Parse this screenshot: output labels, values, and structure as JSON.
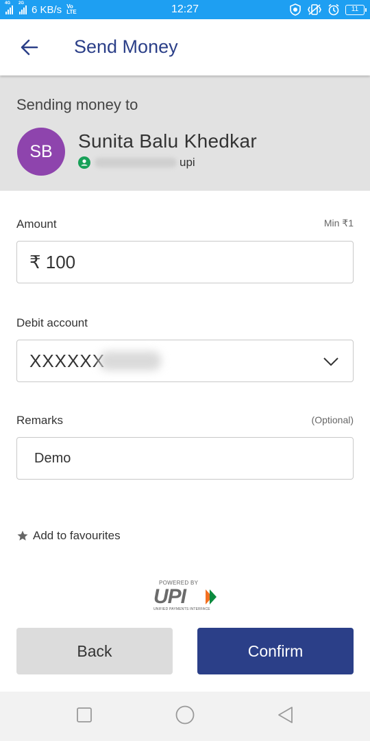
{
  "status_bar": {
    "network_tag_1": "4G",
    "network_tag_2": "2G",
    "speed": "6 KB/s",
    "volte_1": "Vo",
    "volte_2": "LTE",
    "time": "12:27",
    "battery": "11"
  },
  "header": {
    "title": "Send Money"
  },
  "recipient": {
    "label": "Sending money to",
    "initials": "SB",
    "name": "Sunita Balu Khedkar",
    "upi_suffix": "upi",
    "avatar_color": "#8e44ad"
  },
  "amount": {
    "label": "Amount",
    "hint": "Min ₹1",
    "value": "₹ 100"
  },
  "debit": {
    "label": "Debit account",
    "value": "XXXXXX"
  },
  "remarks": {
    "label": "Remarks",
    "hint": "(Optional)",
    "value": "Demo"
  },
  "favourites": {
    "label": "Add to favourites"
  },
  "upi_logo": {
    "powered_by": "POWERED BY",
    "word": "UPI",
    "subtitle": "UNIFIED PAYMENTS INTERFACE"
  },
  "actions": {
    "back_label": "Back",
    "confirm_label": "Confirm"
  },
  "colors": {
    "status_bar": "#1e9ff2",
    "primary": "#2b3f88",
    "verified": "#18a058"
  }
}
